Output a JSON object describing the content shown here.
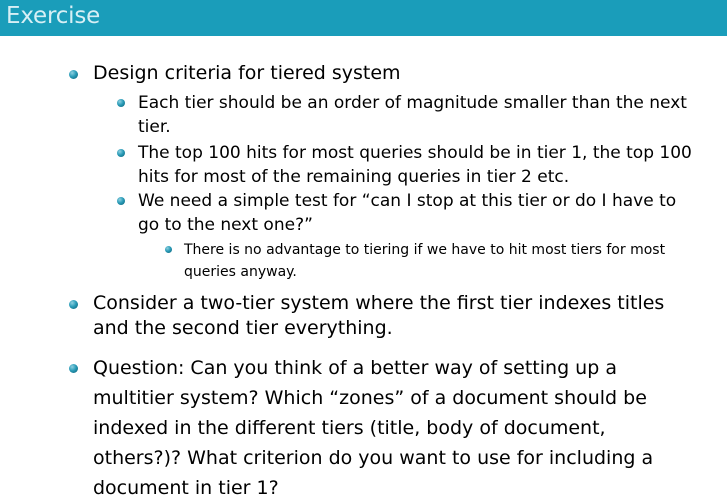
{
  "header": {
    "title": "Exercise",
    "bar_color": "#1a9dba",
    "title_color": "#d7eff5"
  },
  "bullet_color": "#1a8fb0",
  "content": {
    "items": [
      {
        "text": "Design criteria for tiered system",
        "subitems": [
          {
            "text": "Each tier should be an order of magnitude smaller than the next tier."
          },
          {
            "text": "The top 100 hits for most queries should be in tier 1, the top 100 hits for most of the remaining queries in tier 2 etc."
          },
          {
            "text": "We need a simple test for “can I stop at this tier or do I have to go to the next one?”",
            "subitems": [
              {
                "text": "There is no advantage to tiering if we have to hit most tiers for most queries anyway."
              }
            ]
          }
        ]
      },
      {
        "text": "Consider a two-tier system where the first tier indexes titles and the second tier everything."
      },
      {
        "text": "Question: Can you think of a better way of setting up a multitier system? Which “zones” of a document should be indexed in the different tiers (title, body of document, others?)? What criterion do you want to use for including a document in tier 1?"
      }
    ]
  }
}
